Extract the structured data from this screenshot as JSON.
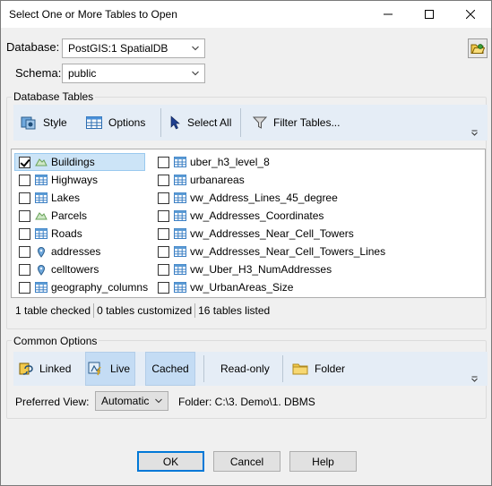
{
  "window": {
    "title": "Select One or More Tables to Open"
  },
  "database": {
    "label": "Database:",
    "value": "PostGIS:1 SpatialDB"
  },
  "schema": {
    "label": "Schema:",
    "value": "public"
  },
  "tables_group": {
    "label": "Database Tables",
    "toolbar": {
      "style": "Style",
      "options": "Options",
      "select_all": "Select All",
      "filter": "Filter Tables..."
    },
    "left_items": [
      {
        "name": "Buildings",
        "checked": true,
        "icon": "area-icon"
      },
      {
        "name": "Highways",
        "checked": false,
        "icon": "table-icon"
      },
      {
        "name": "Lakes",
        "checked": false,
        "icon": "table-icon"
      },
      {
        "name": "Parcels",
        "checked": false,
        "icon": "area-icon"
      },
      {
        "name": "Roads",
        "checked": false,
        "icon": "table-icon"
      },
      {
        "name": "addresses",
        "checked": false,
        "icon": "point-icon"
      },
      {
        "name": "celltowers",
        "checked": false,
        "icon": "point-icon"
      },
      {
        "name": "geography_columns",
        "checked": false,
        "icon": "table-icon"
      }
    ],
    "right_items": [
      {
        "name": "uber_h3_level_8",
        "checked": false,
        "icon": "table-icon"
      },
      {
        "name": "urbanareas",
        "checked": false,
        "icon": "table-icon"
      },
      {
        "name": "vw_Address_Lines_45_degree",
        "checked": false,
        "icon": "table-icon"
      },
      {
        "name": "vw_Addresses_Coordinates",
        "checked": false,
        "icon": "table-icon"
      },
      {
        "name": "vw_Addresses_Near_Cell_Towers",
        "checked": false,
        "icon": "table-icon"
      },
      {
        "name": "vw_Addresses_Near_Cell_Towers_Lines",
        "checked": false,
        "icon": "table-icon"
      },
      {
        "name": "vw_Uber_H3_NumAddresses",
        "checked": false,
        "icon": "table-icon"
      },
      {
        "name": "vw_UrbanAreas_Size",
        "checked": false,
        "icon": "table-icon"
      }
    ],
    "status": {
      "checked": "1 table checked",
      "customized": "0 tables customized",
      "listed": "16 tables listed"
    }
  },
  "common_group": {
    "label": "Common Options",
    "toolbar": {
      "linked": "Linked",
      "live": "Live",
      "cached": "Cached",
      "readonly": "Read-only",
      "folder": "Folder"
    },
    "preferred_view": {
      "label": "Preferred View:",
      "value": "Automatic"
    },
    "folder_path": "Folder: C:\\3. Demo\\1. DBMS"
  },
  "buttons": {
    "ok": "OK",
    "cancel": "Cancel",
    "help": "Help"
  },
  "colors": {
    "toolbar_bg": "#e5edf6",
    "selected_bg": "#c4dcf4",
    "accent": "#0078d7"
  }
}
